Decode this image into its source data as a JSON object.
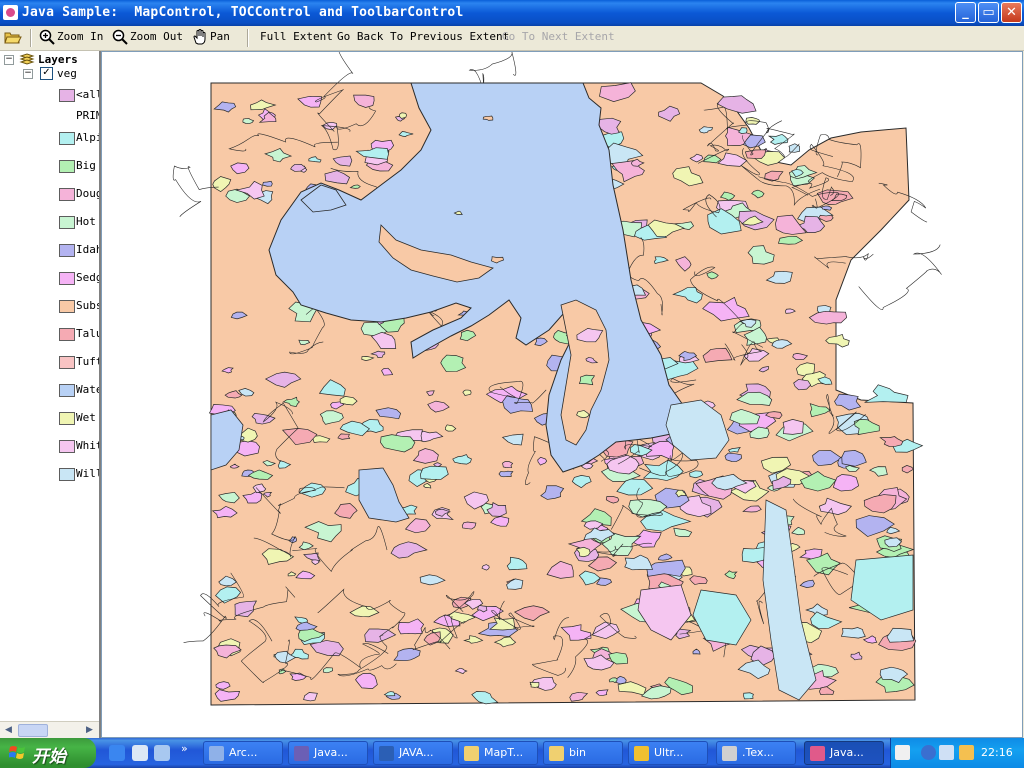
{
  "window": {
    "title": "Java Sample:  MapControl, TOCControl and ToolbarControl",
    "minimize_label": "_",
    "maximize_label": "▭",
    "close_label": "✕"
  },
  "toolbar": {
    "zoom_in": "Zoom In",
    "zoom_out": "Zoom Out",
    "pan": "Pan",
    "full_extent": "Full Extent",
    "go_back": "Go Back To Previous Extent",
    "go_next": "Go To Next Extent"
  },
  "toc": {
    "root_label": "Layers",
    "layer_name": "veg",
    "layer_checked": true,
    "field_label": "PRIM",
    "legend": [
      {
        "label": "<all",
        "color": "#e6b3e6"
      },
      {
        "label": "Alpi",
        "color": "#b3f0f0"
      },
      {
        "label": "Big ",
        "color": "#b3f0b3"
      },
      {
        "label": "Doug",
        "color": "#f5b3d9"
      },
      {
        "label": "Hot ",
        "color": "#c8f5d2"
      },
      {
        "label": "Idah",
        "color": "#b3b3f0"
      },
      {
        "label": "Sedg",
        "color": "#f5b3f5"
      },
      {
        "label": "Subs",
        "color": "#f8c9a6"
      },
      {
        "label": "Talu",
        "color": "#f5aab3"
      },
      {
        "label": "Tuft",
        "color": "#f8c3c3"
      },
      {
        "label": "Wate",
        "color": "#b8d1f5"
      },
      {
        "label": "Wet ",
        "color": "#f0f5b3"
      },
      {
        "label": "Whit",
        "color": "#f5c6f0"
      },
      {
        "label": "Will",
        "color": "#c9e6f5"
      }
    ]
  },
  "taskbar": {
    "start_label": "开始",
    "tasks": [
      {
        "label": "Arc...",
        "color": "#8fb1e8"
      },
      {
        "label": "Java...",
        "color": "#6b5fb5"
      },
      {
        "label": "JAVA...",
        "color": "#2b5fb5"
      },
      {
        "label": "MapT...",
        "color": "#f0d070"
      },
      {
        "label": "bin",
        "color": "#f0d070"
      },
      {
        "label": "Ultr...",
        "color": "#f0c030"
      },
      {
        "label": ".Tex...",
        "color": "#d0d0d0"
      },
      {
        "label": "Java...",
        "color": "#e05a8a"
      }
    ],
    "clock": "22:16"
  }
}
